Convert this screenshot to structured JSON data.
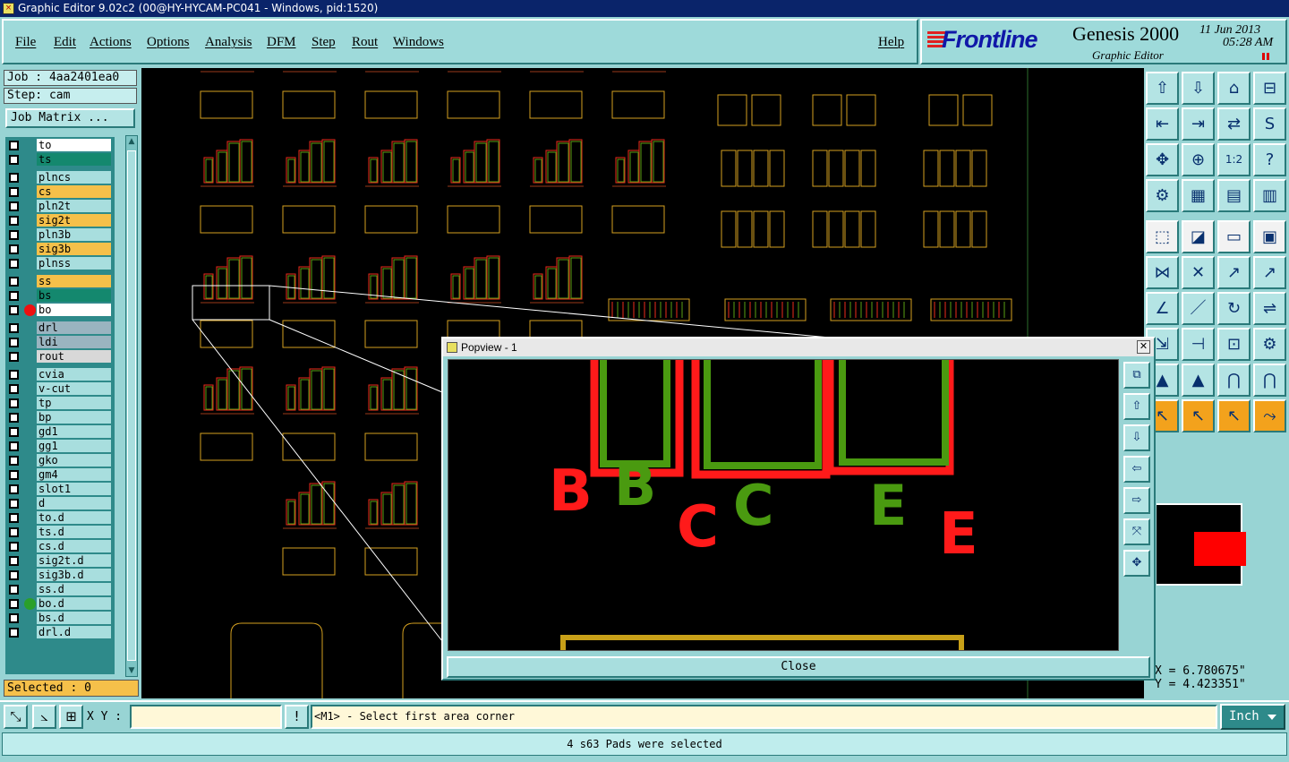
{
  "window": {
    "title": "Graphic Editor 9.02c2 (00@HY-HYCAM-PC041 - Windows, pid:1520)"
  },
  "menu": {
    "items": [
      {
        "label": "File"
      },
      {
        "label": "Edit"
      },
      {
        "label": "Actions"
      },
      {
        "label": "Options"
      },
      {
        "label": "Analysis"
      },
      {
        "label": "DFM"
      },
      {
        "label": "Step"
      },
      {
        "label": "Rout"
      },
      {
        "label": "Windows"
      }
    ],
    "help": "Help"
  },
  "brand": {
    "logo": "Frontline",
    "product": "Genesis 2000",
    "subtitle": "Graphic Editor",
    "date": "11 Jun 2013",
    "time": "05:28 AM",
    "accent_color": "#1018a8",
    "logo_stripe_color": "#e02020"
  },
  "left": {
    "job": "Job : 4aa2401ea0",
    "step": "Step: cam",
    "job_matrix": "Job Matrix ...",
    "selected": "Selected : 0",
    "layers": [
      {
        "name": "to",
        "bg": "#ffffff"
      },
      {
        "name": "ts",
        "bg": "#14886e"
      },
      {
        "name": "plncs",
        "bg": "#a8dede"
      },
      {
        "name": "cs",
        "bg": "#f5c04a"
      },
      {
        "name": "pln2t",
        "bg": "#a8dede"
      },
      {
        "name": "sig2t",
        "bg": "#f5c04a"
      },
      {
        "name": "pln3b",
        "bg": "#a8dede"
      },
      {
        "name": "sig3b",
        "bg": "#f5c04a"
      },
      {
        "name": "plnss",
        "bg": "#a8dede"
      },
      {
        "name": "ss",
        "bg": "#f5c04a"
      },
      {
        "name": "bs",
        "bg": "#14886e"
      },
      {
        "name": "bo",
        "bg": "#ffffff",
        "dot": "#ee1111",
        "active": true
      },
      {
        "name": "drl",
        "bg": "#9ab4c0"
      },
      {
        "name": "ldi",
        "bg": "#9ab4c0"
      },
      {
        "name": "rout",
        "bg": "#d8d8d8"
      },
      {
        "name": "cvia",
        "bg": "#a8dede"
      },
      {
        "name": "v-cut",
        "bg": "#a8dede"
      },
      {
        "name": "tp",
        "bg": "#a8dede"
      },
      {
        "name": "bp",
        "bg": "#a8dede"
      },
      {
        "name": "gd1",
        "bg": "#a8dede"
      },
      {
        "name": "gg1",
        "bg": "#a8dede"
      },
      {
        "name": "gko",
        "bg": "#a8dede"
      },
      {
        "name": "gm4",
        "bg": "#a8dede"
      },
      {
        "name": "slot1",
        "bg": "#a8dede"
      },
      {
        "name": "d",
        "bg": "#a8dede"
      },
      {
        "name": "to.d",
        "bg": "#a8dede"
      },
      {
        "name": "ts.d",
        "bg": "#a8dede"
      },
      {
        "name": "cs.d",
        "bg": "#a8dede"
      },
      {
        "name": "sig2t.d",
        "bg": "#a8dede"
      },
      {
        "name": "sig3b.d",
        "bg": "#a8dede"
      },
      {
        "name": "ss.d",
        "bg": "#a8dede"
      },
      {
        "name": "bo.d",
        "bg": "#a8dede",
        "dot": "#2aa02a"
      },
      {
        "name": "bs.d",
        "bg": "#a8dede"
      },
      {
        "name": "drl.d",
        "bg": "#a8dede"
      }
    ]
  },
  "right": {
    "coords": {
      "x": "X = 6.780675\"",
      "y": "Y = 4.423351\""
    },
    "buttons": [
      "home-up-icon",
      "home-down-icon",
      "house-icon",
      "window-split-icon",
      "zoom-left-icon",
      "zoom-right-icon",
      "flip-icon",
      "snake-icon",
      "fit-screen-icon",
      "fit-center-icon",
      "scale-1-2-icon",
      "help-icon",
      "measure-icon",
      "grid-icon",
      "layers-red-icon",
      "layers-blue-icon",
      "select-point-icon",
      "draw-line-icon",
      "ruler-icon",
      "point-icon",
      "nodes-icon",
      "cross-icon",
      "red-dot-icon",
      "blue-dot-icon",
      "angle-icon",
      "diagonal-icon",
      "rotate-icon",
      "mirror-icon",
      "edge-icon",
      "merge-icon",
      "range-icon",
      "gears-icon",
      "triangle-icon",
      "triangle-red-icon",
      "arch-icon",
      "arch-red-icon",
      "pointer-icon",
      "pointer-box-icon",
      "pointer-zoom-icon",
      "connect-icon"
    ]
  },
  "popview": {
    "title": "Popview - 1",
    "close_label": "Close",
    "letters_red": [
      "B",
      "C",
      "E"
    ],
    "letters_green": [
      "B",
      "C",
      "E"
    ]
  },
  "status": {
    "xy_label": "X Y :",
    "xy_value": "",
    "prompt": "<M1> - Select first area corner",
    "unit": "Inch",
    "message": "4 s63 Pads were selected"
  }
}
